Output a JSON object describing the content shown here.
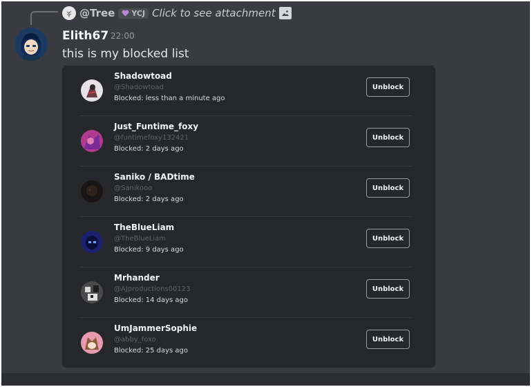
{
  "reply": {
    "author": "@Tree",
    "tag": "YCJ",
    "text": "Click to see attachment",
    "avatar_icon": "tree-avatar",
    "tag_icon": "heart-icon",
    "attachment_icon": "image-icon"
  },
  "message": {
    "author": "Elith67",
    "timestamp": "22:00",
    "text": "this is my blocked list"
  },
  "blocked_list": {
    "button_label": "Unblock",
    "items": [
      {
        "name": "Shadowtoad",
        "handle": "@Shadowtoad",
        "blocked": "Blocked: less than a minute ago",
        "avatar_color": "#e8e2e6"
      },
      {
        "name": "Just_Funtime_foxy",
        "handle": "@funtimefoxy132421",
        "blocked": "Blocked: 2 days ago",
        "avatar_color": "#b03a8f"
      },
      {
        "name": "Saniko / BADtime",
        "handle": "@Sanikooo",
        "blocked": "Blocked: 2 days ago",
        "avatar_color": "#1a1412"
      },
      {
        "name": "TheBlueLiam",
        "handle": "@TheBlueLiam",
        "blocked": "Blocked: 9 days ago",
        "avatar_color": "#1a1f6e"
      },
      {
        "name": "Mrhander",
        "handle": "@AJproductions00123",
        "blocked": "Blocked: 14 days ago",
        "avatar_color": "#4a4a4a"
      },
      {
        "name": "UmJammerSophie",
        "handle": "@abby_foxo",
        "blocked": "Blocked: 25 days ago",
        "avatar_color": "#e99ab0"
      }
    ]
  },
  "colors": {
    "background": "#393b40",
    "card": "#25272b",
    "text_primary": "#f2f3f5",
    "text_muted": "#949ba4"
  }
}
